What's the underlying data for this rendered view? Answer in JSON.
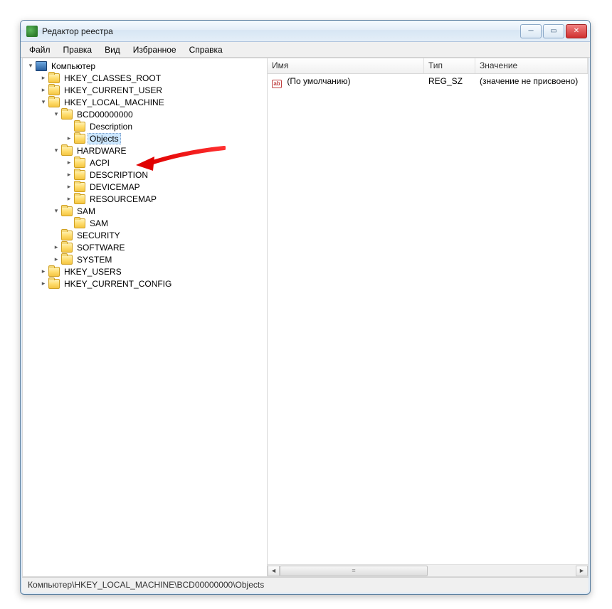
{
  "window": {
    "title": "Редактор реестра"
  },
  "menu": {
    "file": "Файл",
    "edit": "Правка",
    "view": "Вид",
    "favorites": "Избранное",
    "help": "Справка"
  },
  "tree": {
    "root": "Компьютер",
    "hkcr": "HKEY_CLASSES_ROOT",
    "hkcu": "HKEY_CURRENT_USER",
    "hklm": "HKEY_LOCAL_MACHINE",
    "bcd": "BCD00000000",
    "bcd_desc": "Description",
    "bcd_obj": "Objects",
    "hardware": "HARDWARE",
    "acpi": "ACPI",
    "description": "DESCRIPTION",
    "devicemap": "DEVICEMAP",
    "resourcemap": "RESOURCEMAP",
    "sam": "SAM",
    "sam2": "SAM",
    "security": "SECURITY",
    "software": "SOFTWARE",
    "system": "SYSTEM",
    "hku": "HKEY_USERS",
    "hkcc": "HKEY_CURRENT_CONFIG"
  },
  "list": {
    "col_name": "Имя",
    "col_type": "Тип",
    "col_value": "Значение",
    "row0_name": "(По умолчанию)",
    "row0_type": "REG_SZ",
    "row0_value": "(значение не присвоено)"
  },
  "status": {
    "path": "Компьютер\\HKEY_LOCAL_MACHINE\\BCD00000000\\Objects"
  }
}
